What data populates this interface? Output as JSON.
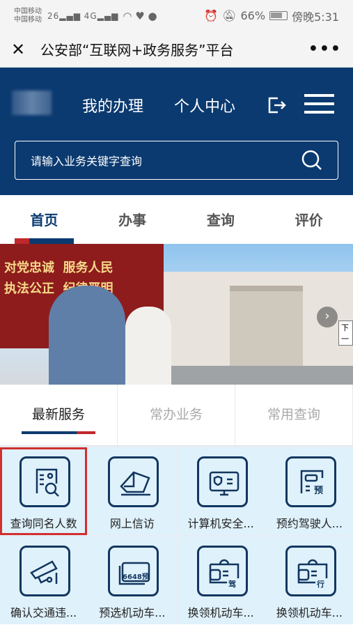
{
  "status_bar": {
    "carrier1": "中国移动",
    "carrier2": "中国移动",
    "sig1": "26",
    "sig2": "4G",
    "battery": "66%",
    "time": "傍晚5:31"
  },
  "titlebar": {
    "title": "公安部“互联网+政务服务”平台",
    "more": "•••"
  },
  "header": {
    "nav": [
      "我的办理",
      "个人中心"
    ],
    "search_placeholder": "请输入业务关键字查询"
  },
  "tabs": [
    {
      "label": "首页",
      "active": true
    },
    {
      "label": "办事"
    },
    {
      "label": "查询"
    },
    {
      "label": "评价"
    }
  ],
  "banner": {
    "slogan": "对党忠诚  服务人民\n执法公正  纪律严明",
    "tooltip": "下一"
  },
  "service_tabs": [
    {
      "label": "最新服务",
      "active": true
    },
    {
      "label": "常办业务"
    },
    {
      "label": "常用查询"
    }
  ],
  "services": [
    {
      "label": "查询同名人数",
      "icon": "id-search-icon",
      "selected": true
    },
    {
      "label": "网上信访",
      "icon": "envelope-icon"
    },
    {
      "label": "计算机安全...",
      "icon": "monitor-shield-icon"
    },
    {
      "label": "预约驾驶人...",
      "icon": "car-reserve-icon"
    },
    {
      "label": "确认交通违...",
      "icon": "camera-icon"
    },
    {
      "label": "预选机动车...",
      "icon": "plate-icon",
      "badge": "6648预"
    },
    {
      "label": "换领机动车...",
      "icon": "car-license-icon",
      "badge": "驾"
    },
    {
      "label": "换领机动车...",
      "icon": "car-license-icon",
      "badge": "行"
    }
  ],
  "colors": {
    "navy": "#0b3a70",
    "accent_red": "#c0282c",
    "cell_bg": "#dff1fb"
  }
}
